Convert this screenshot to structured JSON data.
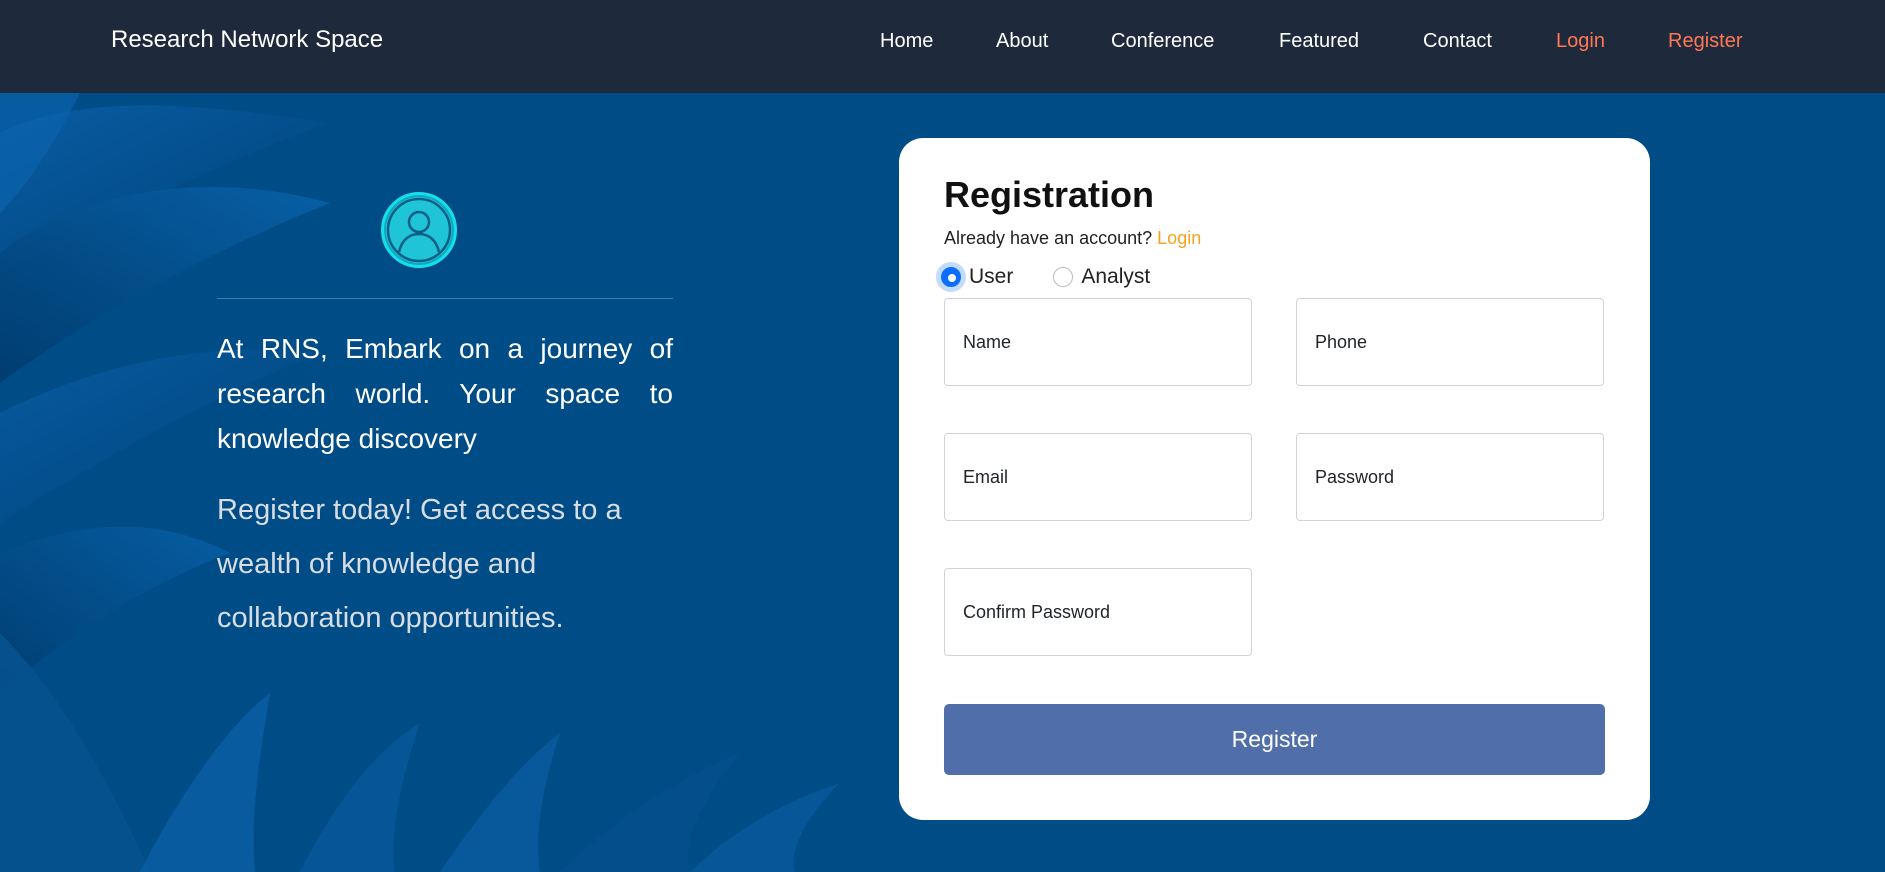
{
  "brand": "Research Network Space",
  "nav": {
    "home": "Home",
    "about": "About",
    "conference": "Conference",
    "featured": "Featured",
    "contact": "Contact",
    "login": "Login",
    "register": "Register"
  },
  "hero": {
    "avatar_icon": "user-circle-icon",
    "tagline": "At RNS, Embark on a journey of research world. Your space to knowledge discovery",
    "subtag": "Register today! Get access to a wealth of knowledge and collaboration opportunities."
  },
  "form": {
    "title": "Registration",
    "login_prompt": "Already have an account?",
    "login_link": "Login",
    "role_options": [
      "User",
      "Analyst"
    ],
    "selected_role": "User",
    "fields": {
      "name": "Name",
      "phone": "Phone",
      "email": "Email",
      "password": "Password",
      "confirm_password": "Confirm Password"
    },
    "submit_label": "Register"
  },
  "colors": {
    "navbar": "#1e2a3b",
    "background": "#004c87",
    "accent_nav": "#ff7755",
    "login_link": "#f5a21e",
    "submit": "#506ea9",
    "avatar": "#1fc4d6"
  }
}
